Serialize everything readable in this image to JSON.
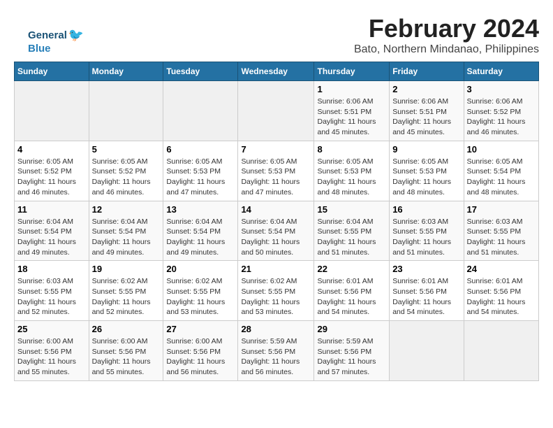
{
  "logo": {
    "general": "General",
    "blue": "Blue"
  },
  "header": {
    "title": "February 2024",
    "subtitle": "Bato, Northern Mindanao, Philippines"
  },
  "weekdays": [
    "Sunday",
    "Monday",
    "Tuesday",
    "Wednesday",
    "Thursday",
    "Friday",
    "Saturday"
  ],
  "weeks": [
    [
      {
        "day": "",
        "info": ""
      },
      {
        "day": "",
        "info": ""
      },
      {
        "day": "",
        "info": ""
      },
      {
        "day": "",
        "info": ""
      },
      {
        "day": "1",
        "info": "Sunrise: 6:06 AM\nSunset: 5:51 PM\nDaylight: 11 hours and 45 minutes."
      },
      {
        "day": "2",
        "info": "Sunrise: 6:06 AM\nSunset: 5:51 PM\nDaylight: 11 hours and 45 minutes."
      },
      {
        "day": "3",
        "info": "Sunrise: 6:06 AM\nSunset: 5:52 PM\nDaylight: 11 hours and 46 minutes."
      }
    ],
    [
      {
        "day": "4",
        "info": "Sunrise: 6:05 AM\nSunset: 5:52 PM\nDaylight: 11 hours and 46 minutes."
      },
      {
        "day": "5",
        "info": "Sunrise: 6:05 AM\nSunset: 5:52 PM\nDaylight: 11 hours and 46 minutes."
      },
      {
        "day": "6",
        "info": "Sunrise: 6:05 AM\nSunset: 5:53 PM\nDaylight: 11 hours and 47 minutes."
      },
      {
        "day": "7",
        "info": "Sunrise: 6:05 AM\nSunset: 5:53 PM\nDaylight: 11 hours and 47 minutes."
      },
      {
        "day": "8",
        "info": "Sunrise: 6:05 AM\nSunset: 5:53 PM\nDaylight: 11 hours and 48 minutes."
      },
      {
        "day": "9",
        "info": "Sunrise: 6:05 AM\nSunset: 5:53 PM\nDaylight: 11 hours and 48 minutes."
      },
      {
        "day": "10",
        "info": "Sunrise: 6:05 AM\nSunset: 5:54 PM\nDaylight: 11 hours and 48 minutes."
      }
    ],
    [
      {
        "day": "11",
        "info": "Sunrise: 6:04 AM\nSunset: 5:54 PM\nDaylight: 11 hours and 49 minutes."
      },
      {
        "day": "12",
        "info": "Sunrise: 6:04 AM\nSunset: 5:54 PM\nDaylight: 11 hours and 49 minutes."
      },
      {
        "day": "13",
        "info": "Sunrise: 6:04 AM\nSunset: 5:54 PM\nDaylight: 11 hours and 49 minutes."
      },
      {
        "day": "14",
        "info": "Sunrise: 6:04 AM\nSunset: 5:54 PM\nDaylight: 11 hours and 50 minutes."
      },
      {
        "day": "15",
        "info": "Sunrise: 6:04 AM\nSunset: 5:55 PM\nDaylight: 11 hours and 51 minutes."
      },
      {
        "day": "16",
        "info": "Sunrise: 6:03 AM\nSunset: 5:55 PM\nDaylight: 11 hours and 51 minutes."
      },
      {
        "day": "17",
        "info": "Sunrise: 6:03 AM\nSunset: 5:55 PM\nDaylight: 11 hours and 51 minutes."
      }
    ],
    [
      {
        "day": "18",
        "info": "Sunrise: 6:03 AM\nSunset: 5:55 PM\nDaylight: 11 hours and 52 minutes."
      },
      {
        "day": "19",
        "info": "Sunrise: 6:02 AM\nSunset: 5:55 PM\nDaylight: 11 hours and 52 minutes."
      },
      {
        "day": "20",
        "info": "Sunrise: 6:02 AM\nSunset: 5:55 PM\nDaylight: 11 hours and 53 minutes."
      },
      {
        "day": "21",
        "info": "Sunrise: 6:02 AM\nSunset: 5:55 PM\nDaylight: 11 hours and 53 minutes."
      },
      {
        "day": "22",
        "info": "Sunrise: 6:01 AM\nSunset: 5:56 PM\nDaylight: 11 hours and 54 minutes."
      },
      {
        "day": "23",
        "info": "Sunrise: 6:01 AM\nSunset: 5:56 PM\nDaylight: 11 hours and 54 minutes."
      },
      {
        "day": "24",
        "info": "Sunrise: 6:01 AM\nSunset: 5:56 PM\nDaylight: 11 hours and 54 minutes."
      }
    ],
    [
      {
        "day": "25",
        "info": "Sunrise: 6:00 AM\nSunset: 5:56 PM\nDaylight: 11 hours and 55 minutes."
      },
      {
        "day": "26",
        "info": "Sunrise: 6:00 AM\nSunset: 5:56 PM\nDaylight: 11 hours and 55 minutes."
      },
      {
        "day": "27",
        "info": "Sunrise: 6:00 AM\nSunset: 5:56 PM\nDaylight: 11 hours and 56 minutes."
      },
      {
        "day": "28",
        "info": "Sunrise: 5:59 AM\nSunset: 5:56 PM\nDaylight: 11 hours and 56 minutes."
      },
      {
        "day": "29",
        "info": "Sunrise: 5:59 AM\nSunset: 5:56 PM\nDaylight: 11 hours and 57 minutes."
      },
      {
        "day": "",
        "info": ""
      },
      {
        "day": "",
        "info": ""
      }
    ]
  ]
}
